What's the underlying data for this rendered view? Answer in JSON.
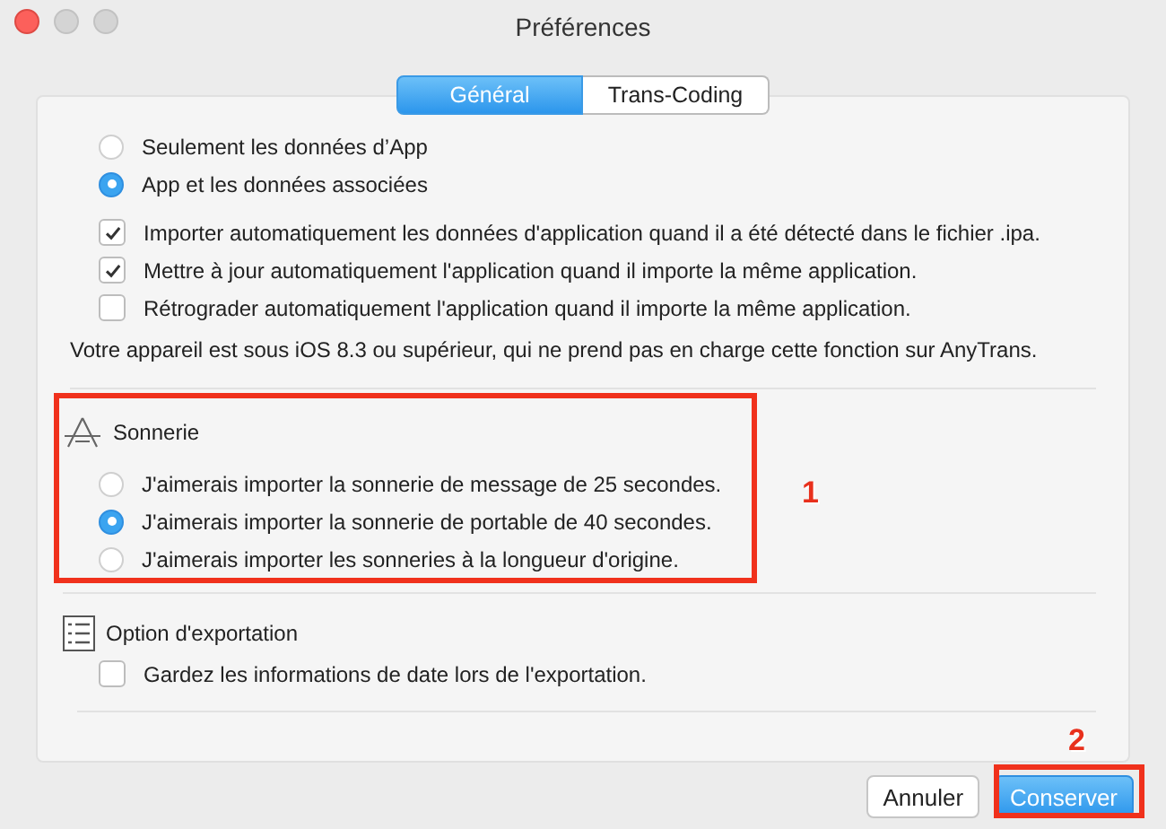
{
  "window": {
    "title": "Préférences"
  },
  "tabs": [
    {
      "label": "Général",
      "selected": true
    },
    {
      "label": "Trans-Coding",
      "selected": false
    }
  ],
  "data_mode": [
    {
      "label": "Seulement les données d’App",
      "selected": false
    },
    {
      "label": "App et les données associées",
      "selected": true
    }
  ],
  "import_options": [
    {
      "label": "Importer automatiquement les données d'application quand il a été détecté dans le fichier .ipa.",
      "checked": true
    },
    {
      "label": "Mettre à jour automatiquement l'application quand il importe la même application.",
      "checked": true
    },
    {
      "label": "Rétrograder automatiquement l'application quand il importe la même application.",
      "checked": false
    }
  ],
  "ios_note": "Votre appareil est sous iOS 8.3 ou supérieur, qui ne prend pas en charge cette fonction sur AnyTrans.",
  "ringtone": {
    "title": "Sonnerie",
    "options": [
      {
        "label": "J'aimerais importer la sonnerie de message de 25 secondes.",
        "selected": false
      },
      {
        "label": "J'aimerais importer la sonnerie de portable de 40 secondes.",
        "selected": true
      },
      {
        "label": "J'aimerais importer les sonneries à la longueur d'origine.",
        "selected": false
      }
    ]
  },
  "export": {
    "title": "Option d'exportation",
    "options": [
      {
        "label": "Gardez les informations de date lors de l'exportation.",
        "checked": false
      }
    ]
  },
  "buttons": [
    {
      "label": "Annuler",
      "kind": "secondary"
    },
    {
      "label": "Conserver",
      "kind": "primary"
    }
  ],
  "annotations": [
    {
      "label": "1"
    },
    {
      "label": "2"
    }
  ]
}
